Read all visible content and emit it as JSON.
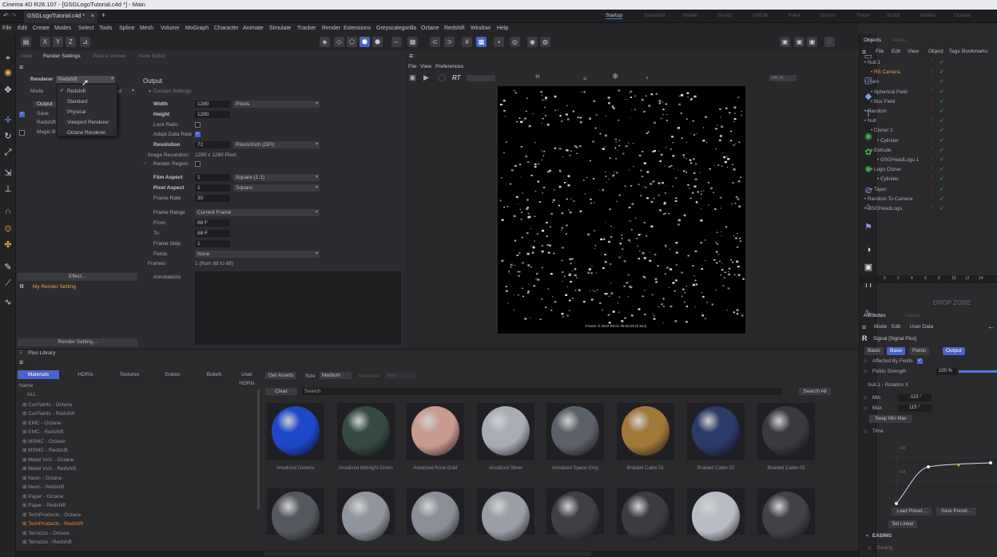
{
  "window": {
    "title": "Cinema 4D R26.107 - [GSGLogoTutorial.c4d *] - Main"
  },
  "doc_tab": {
    "label": "GSGLogoTutorial.c4d *",
    "close": "×",
    "add": "+"
  },
  "layouts": [
    "Startup",
    "Standard",
    "Model",
    "Sculpt",
    "UVEdit",
    "Paint",
    "Groom",
    "Track",
    "Script",
    "Nodes",
    "Octane"
  ],
  "menu": [
    "File",
    "Edit",
    "Create",
    "Modes",
    "Select",
    "Tools",
    "Spline",
    "Mesh",
    "Volume",
    "MoGraph",
    "Character",
    "Animate",
    "Simulate",
    "Tracker",
    "Render",
    "Extensions",
    "Greyscalegorilla",
    "Octane",
    "Redshift",
    "Window",
    "Help"
  ],
  "toolbar": {
    "x": "X",
    "y": "Y",
    "z": "Z"
  },
  "render_settings": {
    "tabs": [
      "View",
      "Render Settings",
      "Picture Viewer",
      "Node Editor"
    ],
    "renderer_label": "Renderer",
    "renderer_value": "Redshift",
    "mode_label": "Mode",
    "mode_value": "Advanced",
    "dropdown_options": [
      "Redshift",
      "Standard",
      "Physical",
      "Viewport Renderer",
      "Octane Renderer"
    ],
    "left_items": [
      "Output",
      "Save",
      "Redshift",
      "Magic B"
    ],
    "effect_button": "Effect...",
    "my_setting": "My Render Setting",
    "render_setting_button": "Render Setting...",
    "output_title": "Output",
    "custom_settings": "Custom Settings",
    "fields": [
      {
        "label": "Width",
        "value": "1280",
        "unit": "Pixels",
        "bold": true
      },
      {
        "label": "Height",
        "value": "1280",
        "bold": true
      },
      {
        "label": "Lock Ratio"
      },
      {
        "label": "Adapt Data Rate"
      },
      {
        "label": "Resolution",
        "value": "72",
        "unit": "Pixels/Inch (DPI)",
        "bold": true
      },
      {
        "label": "Image Resolution:",
        "text": "1280 x 1280 Pixel"
      },
      {
        "label": "Render Region"
      },
      {
        "label": "Film Aspect",
        "value": "1",
        "unit": "Square (1:1)",
        "bold": true
      },
      {
        "label": "Pixel Aspect",
        "value": "1",
        "unit": "Square",
        "bold": true
      },
      {
        "label": "Frame Rate",
        "value": "30"
      },
      {
        "label": "Frame Range",
        "unit": "Current Frame"
      },
      {
        "label": "From",
        "value": "88 F"
      },
      {
        "label": "To",
        "value": "88 F"
      },
      {
        "label": "Frame Step",
        "value": "1"
      },
      {
        "label": "Fields",
        "unit": "None"
      },
      {
        "label": "Frames",
        "text": "1 (from 88 to 88)"
      },
      {
        "label": "Annotations"
      }
    ]
  },
  "viewer": {
    "menu": [
      "File",
      "View",
      "Preferences"
    ],
    "rt": "RT",
    "zoom": "100 %",
    "frame_caption": "Frame: 0 2022-09-01 08:03:29 (0.81s)"
  },
  "plus_library": {
    "title": "Plus Library",
    "tabs": [
      "Materials",
      "HDRIs",
      "Textures",
      "Gobos",
      "Bokeh",
      "User HDRIs"
    ],
    "name_header": "Name",
    "items": [
      "ALL",
      "CarPaints - Octane",
      "CarPaints - Redshift",
      "EMC - Octane",
      "EMC - Redshift",
      "MSMC - Octane",
      "MSMC - Redshift",
      "Metal Vol1 - Octane",
      "Metal Vol1 - Redshift",
      "Neon - Octane",
      "Neon - Redshift",
      "Paper - Octane",
      "Paper - Redshift",
      "TechProducts - Octane",
      "TechProducts - Redshift",
      "Terrazzo - Octane",
      "Terrazzo - Redshift"
    ],
    "highlight_index": 14,
    "get_assets": "Get Assets",
    "size_label": "Size",
    "size_value": "Medium",
    "renderer_label": "Renderer",
    "renderer_value": "Any",
    "clear": "Clear",
    "search": "Search",
    "search_all": "Search All",
    "materials": [
      {
        "name": "Anodized Generic",
        "color": "#1e48c8"
      },
      {
        "name": "Anodized Midnight Green",
        "color": "#354a40"
      },
      {
        "name": "Anodized Rose Gold",
        "color": "#c89a90"
      },
      {
        "name": "Anodized Silver",
        "color": "#a8acb4"
      },
      {
        "name": "Anodized Space Grey",
        "color": "#5c6068"
      },
      {
        "name": "Braided Cable 01",
        "color": "#a07838"
      },
      {
        "name": "Braided Cable 02",
        "color": "#2c3a68"
      },
      {
        "name": "Braided Cable 03",
        "color": "#3a3a3e"
      }
    ],
    "row2_colors": [
      "#55585e",
      "#90949c",
      "#8a8e96",
      "#9a9ea6",
      "#3e4046",
      "#3a3c42",
      "#b8bcc4",
      "#404248"
    ]
  },
  "objects": {
    "tabs": [
      "Objects",
      "Takes"
    ],
    "menu": [
      "File",
      "Edit",
      "View",
      "Object",
      "Tags",
      "Bookmarks"
    ],
    "items": [
      {
        "name": "Null.1",
        "indent": 0,
        "hl": false
      },
      {
        "name": "RS Camera",
        "indent": 1,
        "hl": true
      },
      {
        "name": "Plain",
        "indent": 0,
        "hl": false
      },
      {
        "name": "Spherical Field",
        "indent": 1,
        "hl": false
      },
      {
        "name": "Box Field",
        "indent": 1,
        "hl": false
      },
      {
        "name": "Random",
        "indent": 0,
        "hl": false
      },
      {
        "name": "Null",
        "indent": 0,
        "hl": false
      },
      {
        "name": "Cloner 2",
        "indent": 1,
        "hl": false
      },
      {
        "name": "Cylinder",
        "indent": 2,
        "hl": false
      },
      {
        "name": "Extrude",
        "indent": 1,
        "hl": false
      },
      {
        "name": "GSGHeadLogo.1",
        "indent": 2,
        "hl": false
      },
      {
        "name": "Logo Cloner",
        "indent": 1,
        "hl": false
      },
      {
        "name": "Cylinder",
        "indent": 2,
        "hl": false
      },
      {
        "name": "Taper",
        "indent": 1,
        "hl": false
      },
      {
        "name": "Random To Camera",
        "indent": 0,
        "hl": false
      },
      {
        "name": "GSGHeadLogo",
        "indent": 0,
        "hl": false
      }
    ]
  },
  "timeline_marks": [
    "0",
    "2",
    "4",
    "6",
    "8",
    "10",
    "12",
    "14"
  ],
  "drop_zone": "DROP ZONE",
  "attributes": {
    "tabs": [
      "Attributes",
      "Layers"
    ],
    "menu": [
      "Mode",
      "Edit",
      "User Data"
    ],
    "object": "Signal [Signal Plus]",
    "sub_tabs": [
      "Basic",
      "Base",
      "Fields",
      "Output"
    ],
    "affected_by_fields": "Affected By Fields",
    "fields_strength_label": "Fields Strength",
    "fields_strength_value": "100 %",
    "rotation_label": "Null.1 - Rotation X",
    "min_label": "Min",
    "min_value": "-115 °",
    "max_label": "Max",
    "max_value": "115 °",
    "swap": "Swap Min Max",
    "time": "Time",
    "curve_ticks": [
      "0.8",
      "0.4"
    ],
    "load_preset": "Load Preset...",
    "save_preset": "Save Preset...",
    "set_linear": "Set Linear",
    "easing": "EASING",
    "easing_sub": "Easing"
  }
}
